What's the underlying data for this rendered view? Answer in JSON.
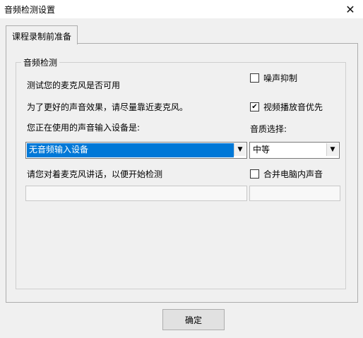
{
  "window": {
    "title": "音频检测设置"
  },
  "tabs": [
    {
      "label": "课程录制前准备"
    }
  ],
  "group": {
    "legend": "音频检测",
    "line1": "测试您的麦克风是否可用",
    "line2": "为了更好的声音效果，请尽量靠近麦克风。",
    "line3": "您正在使用的声音输入设备是:",
    "line4": "请您对着麦克风讲话，以便开始检测"
  },
  "device_select": {
    "value": "无音频输入设备"
  },
  "options": {
    "noise_suppression": {
      "label": "噪声抑制",
      "checked": false
    },
    "video_playback_priority": {
      "label": "视频播放音优先",
      "checked": true
    },
    "quality_label": "音质选择:",
    "quality_select": {
      "value": "中等"
    },
    "merge_system_audio": {
      "label": "合并电脑内声音",
      "checked": false
    }
  },
  "meters": {
    "mic_level": 0,
    "system_level": 0
  },
  "footer": {
    "ok_label": "确定"
  }
}
